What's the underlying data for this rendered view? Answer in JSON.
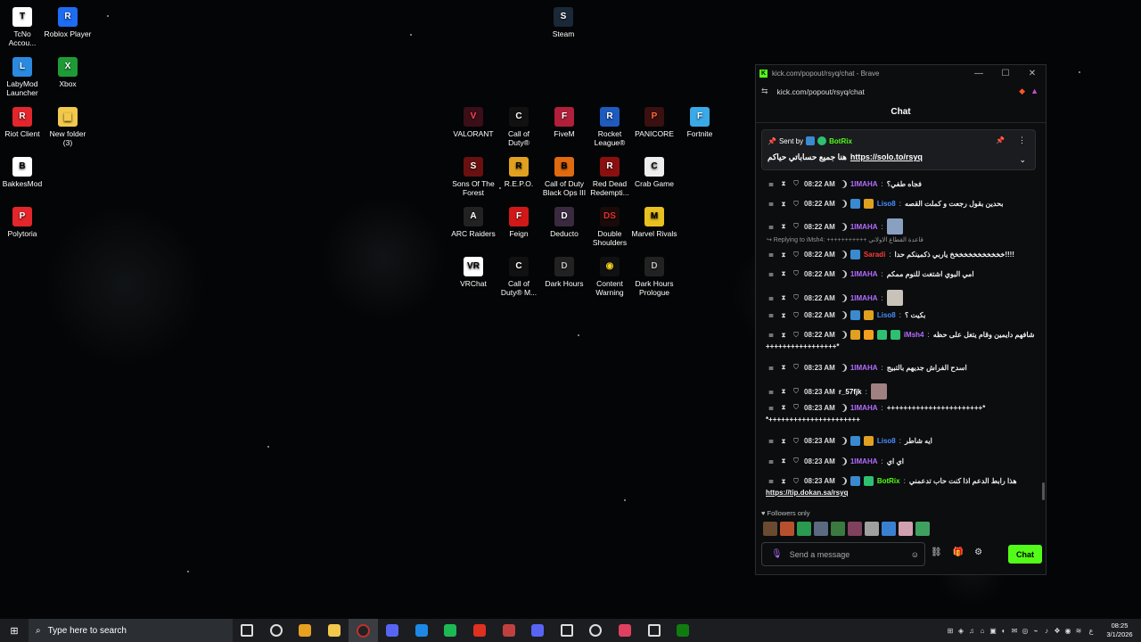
{
  "desktop": {
    "icons": [
      {
        "label": "TcNo\nAccou...",
        "glyph": "T",
        "color": "#ffffff",
        "fg": "#000000"
      },
      {
        "label": "Roblox Player",
        "glyph": "R",
        "color": "#1e6cf2",
        "fg": "#ffffff"
      },
      {
        "label": "LabyMod\nLauncher",
        "glyph": "L",
        "color": "#2a8ae0",
        "fg": "#ffffff"
      },
      {
        "label": "Xbox",
        "glyph": "X",
        "color": "#1e9b36",
        "fg": "#ffffff"
      },
      {
        "label": "Riot Client",
        "glyph": "R",
        "color": "#e2262b",
        "fg": "#ffffff"
      },
      {
        "label": "New folder\n(3)",
        "glyph": "▆",
        "color": "#f2c94c",
        "fg": "#f2c94c"
      },
      {
        "label": "BakkesMod",
        "glyph": "B",
        "color": "#ffffff",
        "fg": "#000000"
      },
      {
        "label": "Polytoria",
        "glyph": "P",
        "color": "#e2262b",
        "fg": "#ffffff"
      },
      {
        "label": "Steam",
        "glyph": "S",
        "color": "#1b2838",
        "fg": "#ffffff"
      },
      {
        "label": "VALORANT",
        "glyph": "V",
        "color": "#3a0f17",
        "fg": "#ff4655"
      },
      {
        "label": "Call of\nDuty®",
        "glyph": "C",
        "color": "#111111",
        "fg": "#ffffff"
      },
      {
        "label": "FiveM",
        "glyph": "F",
        "color": "#b21f3a",
        "fg": "#ffffff"
      },
      {
        "label": "Rocket\nLeague®",
        "glyph": "R",
        "color": "#1d5bbf",
        "fg": "#ffffff"
      },
      {
        "label": "PANICORE",
        "glyph": "P",
        "color": "#3a1010",
        "fg": "#ff6a3a"
      },
      {
        "label": "Fortnite",
        "glyph": "F",
        "color": "#3aa9e8",
        "fg": "#ffffff"
      },
      {
        "label": "Sons Of The\nForest",
        "glyph": "S",
        "color": "#6a1010",
        "fg": "#ffffff"
      },
      {
        "label": "R.E.P.O.",
        "glyph": "R",
        "color": "#e0a020",
        "fg": "#000000"
      },
      {
        "label": "Call of Duty\nBlack Ops III",
        "glyph": "B",
        "color": "#e06a10",
        "fg": "#000000"
      },
      {
        "label": "Red Dead\nRedempti...",
        "glyph": "R",
        "color": "#8a1010",
        "fg": "#ffffff"
      },
      {
        "label": "Crab Game",
        "glyph": "C",
        "color": "#eeeeee",
        "fg": "#000000"
      },
      {
        "label": "ARC Raiders",
        "glyph": "A",
        "color": "#222222",
        "fg": "#ffffff"
      },
      {
        "label": "Feign",
        "glyph": "F",
        "color": "#d01818",
        "fg": "#ffffff"
      },
      {
        "label": "Deducto",
        "glyph": "D",
        "color": "#3a2a40",
        "fg": "#ffffff"
      },
      {
        "label": "Double\nShoulders",
        "glyph": "DS",
        "color": "#1a0a0a",
        "fg": "#e03030"
      },
      {
        "label": "Marvel Rivals",
        "glyph": "M",
        "color": "#e8c020",
        "fg": "#000000"
      },
      {
        "label": "VRChat",
        "glyph": "VR",
        "color": "#ffffff",
        "fg": "#000000"
      },
      {
        "label": "Call of\nDuty® M...",
        "glyph": "C",
        "color": "#111111",
        "fg": "#ffffff"
      },
      {
        "label": "Dark Hours",
        "glyph": "D",
        "color": "#222222",
        "fg": "#bbbbbb"
      },
      {
        "label": "Content\nWarning",
        "glyph": "◉",
        "color": "#111111",
        "fg": "#f2d020"
      },
      {
        "label": "Dark Hours\nPrologue",
        "glyph": "D",
        "color": "#222222",
        "fg": "#bbbbbb"
      }
    ]
  },
  "browser": {
    "title": "kick.com/popout/rsyq/chat - Brave",
    "url": "kick.com/popout/rsyq/chat",
    "controls": {
      "minimize": "—",
      "maximize": "☐",
      "close": "✕"
    },
    "chat_header": "Chat",
    "pinned": {
      "sent_by": "Sent by",
      "bot_name": "BotRix",
      "text": "هنا جميع حساباتي حياكم",
      "link": "https://solo.to/rsyq"
    },
    "reply_note": "↪ Replying to iMsh4: +++++++++++ قاعدة القطاع الاولاني",
    "messages": [
      {
        "time": "08:22 AM",
        "user": "1IMAHA",
        "ucolor": "#b46cff",
        "text": "فجاه طفي؟",
        "badges": []
      },
      {
        "time": "08:22 AM",
        "user": "Liso8",
        "ucolor": "#4a8cff",
        "text": "بحدين بقول رجعت و كملت القصه",
        "badges": [
          "#3a8ad0",
          "#e0a020"
        ]
      },
      {
        "time": "08:22 AM",
        "user": "1IMAHA",
        "ucolor": "#b46cff",
        "text": "",
        "badges": [],
        "emote": "#8aa0c0"
      },
      {
        "time": "08:22 AM",
        "user": "Saradi",
        "ucolor": "#ff3b3b",
        "text": "خخخخخخخخخخخخ ياربي ذكمينكم حدا!!!!",
        "badges": [
          "#3a8ad0"
        ]
      },
      {
        "time": "08:22 AM",
        "user": "1IMAHA",
        "ucolor": "#b46cff",
        "text": "امي البوي اشتغت للنوم ممكم",
        "badges": []
      },
      {
        "time": "08:22 AM",
        "user": "1IMAHA",
        "ucolor": "#b46cff",
        "text": "",
        "badges": [],
        "emote": "#c8c2b8"
      },
      {
        "time": "08:22 AM",
        "user": "Liso8",
        "ucolor": "#4a8cff",
        "text": "بكيت ؟",
        "badges": [
          "#3a8ad0",
          "#e0a020"
        ]
      },
      {
        "time": "08:22 AM",
        "user": "iMsh4",
        "ucolor": "#b46cff",
        "text": "شافهم دايمين وقام يتغل على حظه",
        "badges": [
          "#e0a020",
          "#f2a020",
          "#2fbf71",
          "#2fbf71"
        ],
        "cont": "+++++++++++++++++*"
      },
      {
        "time": "08:23 AM",
        "user": "1IMAHA",
        "ucolor": "#b46cff",
        "text": "اسدح الفراش جديهم بالتبيج",
        "badges": []
      },
      {
        "time": "08:23 AM",
        "user": "r_57fjk",
        "ucolor": "#ffffff",
        "text": "",
        "badges": [],
        "emote": "#a08080",
        "noIcons": true
      },
      {
        "time": "08:23 AM",
        "user": "1IMAHA",
        "ucolor": "#b46cff",
        "text": "+++++++++++++++++++++++*",
        "badges": [],
        "cont": "*++++++++++++++++++++++"
      },
      {
        "time": "08:23 AM",
        "user": "Liso8",
        "ucolor": "#4a8cff",
        "text": "ايه شاطر",
        "badges": [
          "#3a8ad0",
          "#e0a020"
        ]
      },
      {
        "time": "08:23 AM",
        "user": "1IMAHA",
        "ucolor": "#b46cff",
        "text": "اي اي",
        "badges": []
      },
      {
        "time": "08:23 AM",
        "user": "BotRix",
        "ucolor": "#53fc18",
        "text": "هذا رابط الدعم اذا كنت حاب تدعمني",
        "badges": [
          "#3a8ad0",
          "#2fbf71"
        ],
        "cont": "https://tip.dokan.sa/rsyq"
      }
    ],
    "followers_label": "♥ Followers only",
    "emote_bar": [
      "#6a4a30",
      "#b85030",
      "#2a9a50",
      "#5a6a80",
      "#3a7a40",
      "#804060",
      "#a0a0a0",
      "#3a80d0",
      "#d0a0b0",
      "#40a060"
    ],
    "input_placeholder": "Send a message",
    "chat_button": "Chat"
  },
  "taskbar": {
    "search_placeholder": "Type here to search",
    "apps": [
      "#dddddd",
      "#dddddd",
      "#e8a020",
      "#f2c94c",
      "#c03030",
      "#5865f2",
      "#1e88e5",
      "#1db954",
      "#e03020",
      "#c04040",
      "#5865f2",
      "#dddddd",
      "#dddddd",
      "#e04060",
      "#dddddd",
      "#107c10"
    ],
    "tray_icons": [
      "⊞",
      "◈",
      "♫",
      "⌂",
      "▣",
      "◐",
      "✉",
      "◎",
      "⌁",
      "♪",
      "❖",
      "◉",
      "≋"
    ],
    "lang": "ع",
    "time": "08:25",
    "date": "3/1/2026"
  }
}
